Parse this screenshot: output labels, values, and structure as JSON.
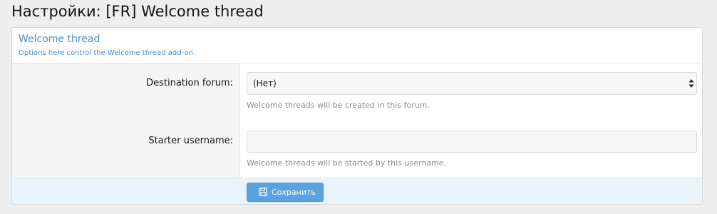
{
  "page": {
    "title": "Настройки: [FR] Welcome thread"
  },
  "panel": {
    "title": "Welcome thread",
    "description": "Options here control the Welcome thread add-on."
  },
  "fields": {
    "destination_forum": {
      "label": "Destination forum:",
      "selected_value": "(Нет)",
      "hint": "Welcome threads will be created in this forum."
    },
    "starter_username": {
      "label": "Starter username:",
      "value": "",
      "placeholder": "",
      "hint": "Welcome threads will be started by this username."
    }
  },
  "footer": {
    "save_label": "Сохранить",
    "save_icon": "save-icon"
  },
  "colors": {
    "accent": "#4a8fc8",
    "button": "#5ba3de",
    "footer_bg": "#e8f3fb",
    "page_bg": "#eeeeee"
  }
}
